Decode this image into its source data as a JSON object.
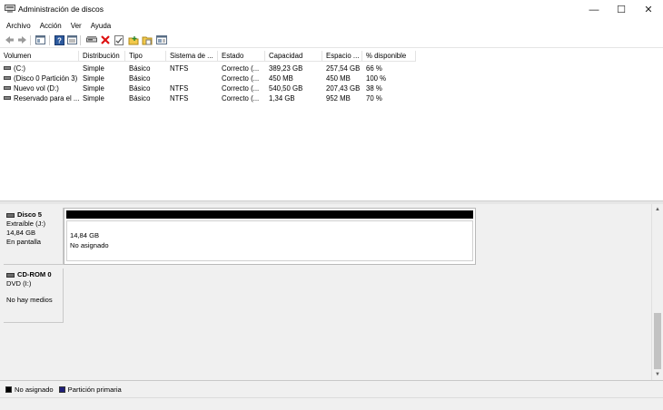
{
  "window": {
    "title": "Administración de discos",
    "min_glyph": "—",
    "max_glyph": "☐",
    "close_glyph": "✕"
  },
  "menu": [
    "Archivo",
    "Acción",
    "Ver",
    "Ayuda"
  ],
  "toolbar": {
    "icons": [
      "back-icon",
      "forward-icon",
      "console-tree-icon",
      "help-icon",
      "properties-icon",
      "connect-drive-icon",
      "delete-icon",
      "check-icon",
      "new-folder-icon",
      "open-file-icon",
      "view-icon"
    ]
  },
  "volumes": {
    "columns": [
      "Volumen",
      "Distribución",
      "Tipo",
      "Sistema de ...",
      "Estado",
      "Capacidad",
      "Espacio ...",
      "% disponible"
    ],
    "rows": [
      [
        "(C:)",
        "Simple",
        "Básico",
        "NTFS",
        "Correcto (...",
        "389,23 GB",
        "257,54 GB",
        "66 %"
      ],
      [
        "(Disco 0 Partición 3)",
        "Simple",
        "Básico",
        "",
        "Correcto (...",
        "450 MB",
        "450 MB",
        "100 %"
      ],
      [
        "Nuevo vol (D:)",
        "Simple",
        "Básico",
        "NTFS",
        "Correcto (...",
        "540,50 GB",
        "207,43 GB",
        "38 %"
      ],
      [
        "Reservado para el ...",
        "Simple",
        "Básico",
        "NTFS",
        "Correcto (...",
        "1,34 GB",
        "952 MB",
        "70 %"
      ]
    ]
  },
  "disks": [
    {
      "name": "Disco 5",
      "type": "Extraíble (J:)",
      "size": "14,84 GB",
      "state": "En pantalla",
      "partition_size": "14,84 GB",
      "partition_status": "No asignado"
    },
    {
      "name": "CD-ROM 0",
      "type": "DVD (I:)",
      "state": "No hay medios"
    }
  ],
  "legend": [
    {
      "label": "No asignado",
      "color": "#000000"
    },
    {
      "label": "Partición primaria",
      "color": "#1f1f7a"
    }
  ]
}
